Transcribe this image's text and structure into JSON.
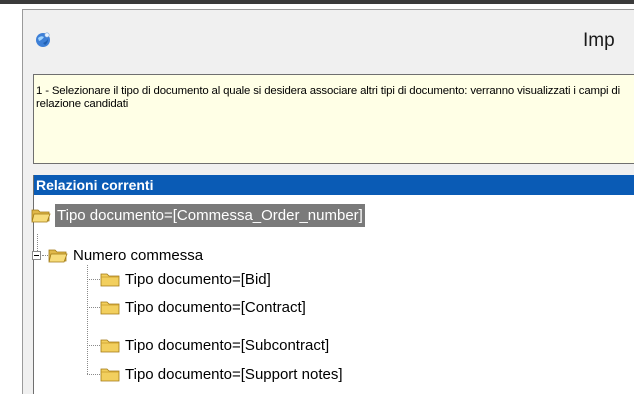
{
  "window": {
    "title": "Imp",
    "icon": "app-globe-icon"
  },
  "instructions": {
    "text": "1 - Selezionare il tipo di documento al quale si desidera associare altri tipi di documento: verranno visualizzati i campi di relazione candidati"
  },
  "relations_panel": {
    "header": "Relazioni correnti",
    "root": {
      "label": "Tipo documento=[Commessa_Order_number]",
      "icon": "folder-open-icon",
      "selected": true
    },
    "group": {
      "label": "Numero commessa",
      "icon": "folder-open-icon",
      "expanded": true
    },
    "children": [
      {
        "label": "Tipo documento=[Bid]",
        "icon": "folder-icon"
      },
      {
        "label": "Tipo documento=[Contract]",
        "icon": "folder-icon"
      },
      {
        "label": "Tipo documento=[Subcontract]",
        "icon": "folder-icon"
      },
      {
        "label": "Tipo documento=[Support notes]",
        "icon": "folder-icon"
      }
    ]
  },
  "colors": {
    "header_bg": "#0a5bb5",
    "instructions_bg": "#ffffe6",
    "selection_bg": "#7a7a7a"
  }
}
